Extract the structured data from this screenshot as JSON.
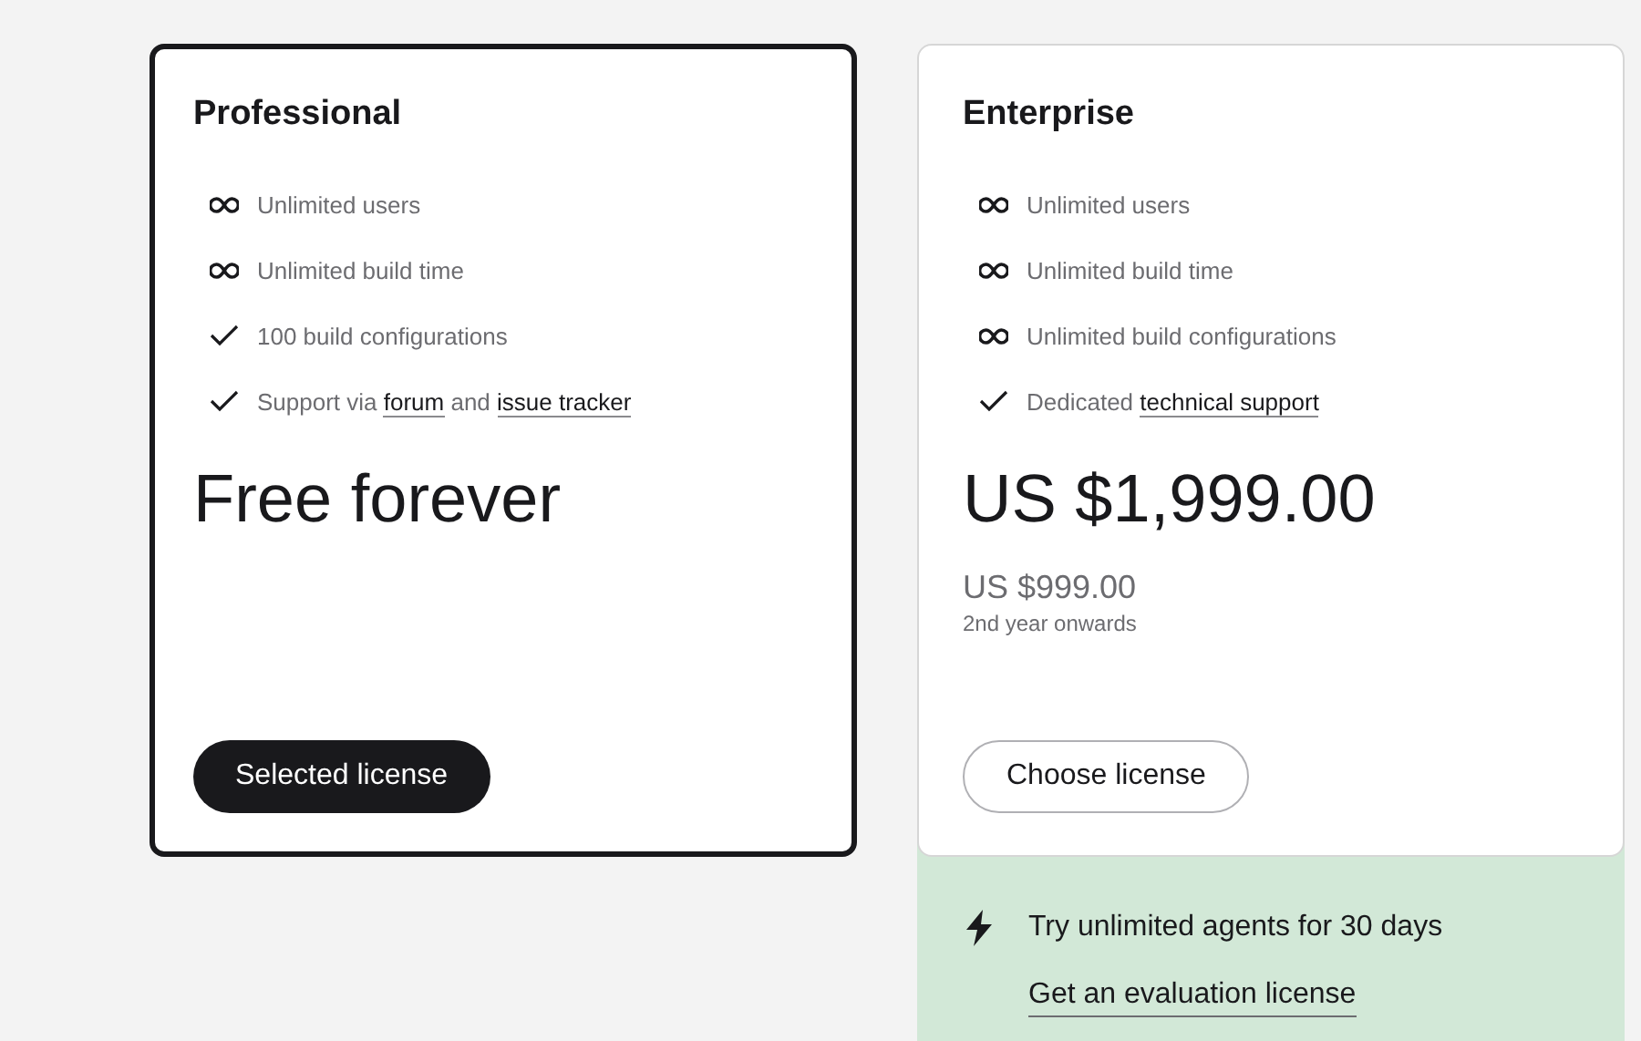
{
  "plans": [
    {
      "name": "Professional",
      "selected": true,
      "features": [
        {
          "kind": "infinity",
          "parts": [
            {
              "kind": "text",
              "text": "Unlimited users"
            }
          ]
        },
        {
          "kind": "infinity",
          "parts": [
            {
              "kind": "text",
              "text": "Unlimited build time"
            }
          ]
        },
        {
          "kind": "check",
          "parts": [
            {
              "kind": "text",
              "text": "100 build configurations"
            }
          ]
        },
        {
          "kind": "check",
          "parts": [
            {
              "kind": "text",
              "text": "Support via "
            },
            {
              "kind": "link",
              "text": "forum"
            },
            {
              "kind": "text",
              "text": " and "
            },
            {
              "kind": "link",
              "text": "issue tracker"
            }
          ]
        }
      ],
      "price": "Free forever",
      "button": "Selected license"
    },
    {
      "name": "Enterprise",
      "selected": false,
      "features": [
        {
          "kind": "infinity",
          "parts": [
            {
              "kind": "text",
              "text": "Unlimited users"
            }
          ]
        },
        {
          "kind": "infinity",
          "parts": [
            {
              "kind": "text",
              "text": "Unlimited build time"
            }
          ]
        },
        {
          "kind": "infinity",
          "parts": [
            {
              "kind": "text",
              "text": "Unlimited build configurations"
            }
          ]
        },
        {
          "kind": "check",
          "parts": [
            {
              "kind": "text",
              "text": "Dedicated "
            },
            {
              "kind": "link",
              "text": "technical support"
            }
          ]
        }
      ],
      "price": "US $1,999.00",
      "renewal_price": "US $999.00",
      "renewal_note": "2nd year onwards",
      "button": "Choose license",
      "evaluation": {
        "text": "Try unlimited agents for 30 days",
        "link": "Get an evaluation license"
      }
    }
  ]
}
